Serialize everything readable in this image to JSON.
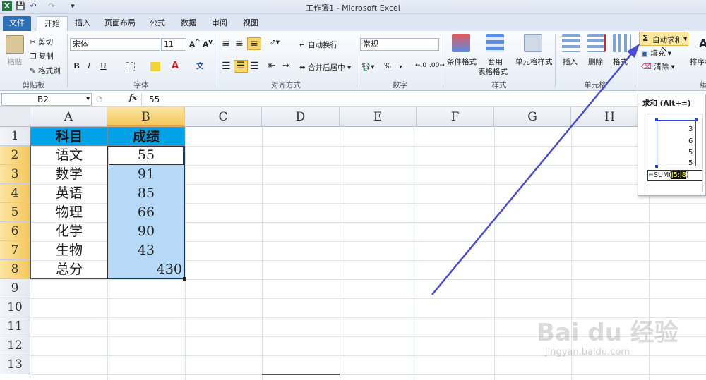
{
  "window": {
    "title": "工作簿1 - Microsoft Excel"
  },
  "tabs": [
    "文件",
    "开始",
    "插入",
    "页面布局",
    "公式",
    "数据",
    "审阅",
    "视图"
  ],
  "ribbon": {
    "clipboard": {
      "paste": "粘贴",
      "cut": "剪切",
      "copy": "复制",
      "format_painter": "格式刷",
      "label": "剪贴板"
    },
    "font": {
      "name": "宋体",
      "size": "11",
      "bold": "B",
      "italic": "I",
      "underline": "U",
      "label": "字体"
    },
    "alignment": {
      "wrap": "自动换行",
      "merge": "合并后居中",
      "label": "对齐方式"
    },
    "number": {
      "format": "常规",
      "percent": "%",
      "comma": ",",
      "label": "数字"
    },
    "styles": {
      "conditional": "条件格式",
      "table_line1": "套用",
      "table_line2": "表格格式",
      "cell_styles": "单元格样式",
      "label": "样式"
    },
    "cells": {
      "insert": "插入",
      "delete": "删除",
      "format": "格式",
      "label": "单元格"
    },
    "editing": {
      "autosum": "自动求和",
      "fill": "填充",
      "clear": "清除",
      "sort": "排序和",
      "label": "编辑"
    }
  },
  "formula_bar": {
    "name_box": "B2",
    "fx": "fx",
    "value": "55"
  },
  "columns": [
    "A",
    "B",
    "C",
    "D",
    "E",
    "F",
    "G",
    "H"
  ],
  "rows": [
    "1",
    "2",
    "3",
    "4",
    "5",
    "6",
    "7",
    "8",
    "9",
    "10",
    "11",
    "12",
    "13"
  ],
  "table": {
    "headers": [
      "科目",
      "成绩"
    ],
    "subjects": [
      "语文",
      "数学",
      "英语",
      "物理",
      "化学",
      "生物",
      "总分"
    ],
    "scores": [
      "55",
      "91",
      "85",
      "66",
      "90",
      "43",
      "430"
    ]
  },
  "tooltip": {
    "title": "求和 (Alt+=)",
    "values": [
      "3",
      "6",
      "5",
      "5"
    ],
    "formula_prefix": "=SUM(",
    "formula_range": "J5:J8",
    "formula_suffix": ")"
  },
  "watermark": {
    "line1": "Bai du 经验",
    "line2": "jingyan.baidu.com"
  },
  "colors": {
    "header_fill": "#00a3e8",
    "selection_fill": "#b5d9f7",
    "arrow": "#4a4ad6"
  }
}
